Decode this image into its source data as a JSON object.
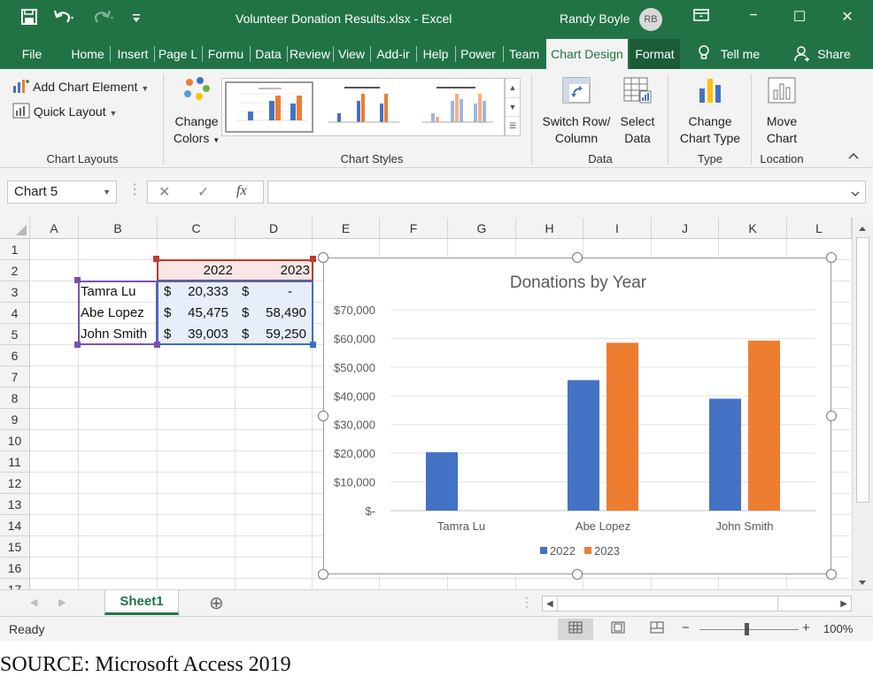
{
  "titlebar": {
    "file_title": "Volunteer Donation Results.xlsx  -  Excel",
    "user_name": "Randy Boyle",
    "user_initials": "RB",
    "minimize": "−",
    "restore": "☐",
    "close": "✕",
    "ribbon_display": "⊡"
  },
  "tabs": [
    "File",
    "Home",
    "Insert",
    "Page L",
    "Formu",
    "Data",
    "Review",
    "View",
    "Add-ir",
    "Help",
    "Power",
    "Team",
    "Chart Design",
    "Format"
  ],
  "tell_me": "Tell me",
  "share": "Share",
  "ribbon": {
    "add_chart_element": "Add Chart Element",
    "quick_layout": "Quick Layout",
    "change_colors_1": "Change",
    "change_colors_2": "Colors",
    "switch_row_1": "Switch Row/",
    "switch_row_2": "Column",
    "select_data_1": "Select",
    "select_data_2": "Data",
    "change_type_1": "Change",
    "change_type_2": "Chart Type",
    "move_chart_1": "Move",
    "move_chart_2": "Chart",
    "groups": {
      "chart_layouts": "Chart Layouts",
      "chart_styles": "Chart Styles",
      "data": "Data",
      "type": "Type",
      "location": "Location"
    }
  },
  "formula_bar": {
    "name_box": "Chart 5",
    "formula": ""
  },
  "columns": [
    "A",
    "B",
    "C",
    "D",
    "E",
    "F",
    "G",
    "H",
    "I",
    "J",
    "K",
    "L"
  ],
  "rows": [
    "1",
    "2",
    "3",
    "4",
    "5",
    "6",
    "7",
    "8",
    "9",
    "10",
    "11",
    "12",
    "13",
    "14",
    "15",
    "16",
    "17"
  ],
  "table": {
    "headers": [
      "2022",
      "2023"
    ],
    "rows": [
      {
        "name": "Tamra Lu",
        "y2022": "20,333",
        "y2023": "-"
      },
      {
        "name": "Abe Lopez",
        "y2022": "45,475",
        "y2023": "58,490"
      },
      {
        "name": "John Smith",
        "y2022": "39,003",
        "y2023": "59,250"
      }
    ],
    "currency": "$"
  },
  "colors": {
    "excel_green": "#217346",
    "series_2022": "#4472c4",
    "series_2023": "#ed7d31"
  },
  "chart_data": {
    "type": "bar",
    "title": "Donations by Year",
    "categories": [
      "Tamra Lu",
      "Abe Lopez",
      "John Smith"
    ],
    "series": [
      {
        "name": "2022",
        "values": [
          20333,
          45475,
          39003
        ],
        "color": "#4472c4"
      },
      {
        "name": "2023",
        "values": [
          0,
          58490,
          59250
        ],
        "color": "#ed7d31"
      }
    ],
    "ylim": [
      0,
      70000
    ],
    "yticks": [
      0,
      10000,
      20000,
      30000,
      40000,
      50000,
      60000,
      70000
    ],
    "ytick_labels": [
      "$-",
      "$10,000",
      "$20,000",
      "$30,000",
      "$40,000",
      "$50,000",
      "$60,000",
      "$70,000"
    ],
    "legend": "bottom",
    "grid": true
  },
  "sheets": {
    "active": "Sheet1",
    "add": "⊕"
  },
  "status": {
    "ready": "Ready",
    "zoom": "100%",
    "zoom_minus": "−",
    "zoom_plus": "+"
  },
  "source_note": "SOURCE: Microsoft Access 2019"
}
